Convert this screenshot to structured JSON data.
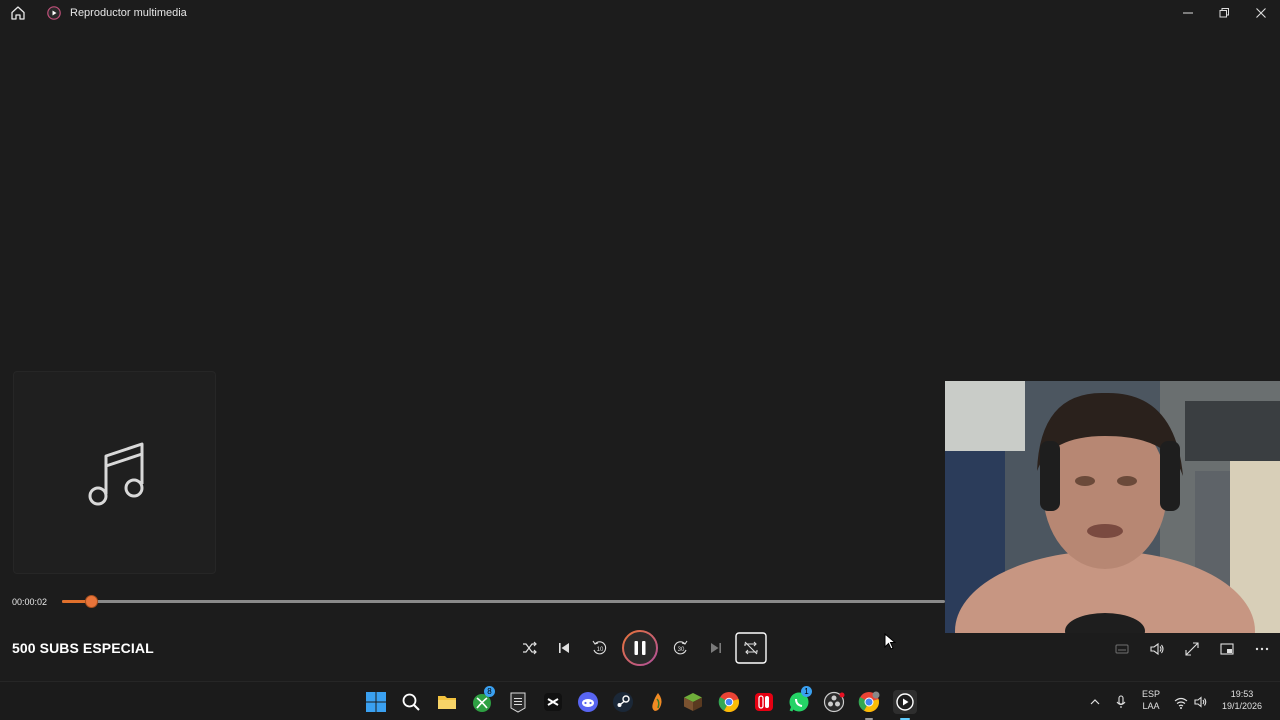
{
  "window": {
    "title": "Reproductor multimedia",
    "icons": {
      "home": "home-icon",
      "app": "media-player-icon",
      "minimize": "minimize-icon",
      "restore": "restore-icon",
      "close": "close-icon"
    }
  },
  "now_playing": {
    "title": "500 SUBS ESPECIAL",
    "elapsed": "00:00:02",
    "progress": 0.033,
    "album_art_icon": "music-note-icon"
  },
  "controls": {
    "shuffle": "shuffle-icon",
    "previous": "previous-icon",
    "rewind": "rewind-10-icon",
    "rewind_seconds": "10",
    "play_pause": "pause-icon",
    "forward": "forward-30-icon",
    "forward_seconds": "30",
    "next": "next-icon",
    "repeat": "repeat-off-icon"
  },
  "right_controls": [
    "captions-icon",
    "volume-icon",
    "fullscreen-icon",
    "miniplayer-icon",
    "more-icon"
  ],
  "colors": {
    "accent": "#e8743a",
    "background": "#1c1c1c",
    "pause_ring": "#c0507a"
  },
  "taskbar": {
    "apps": [
      "windows-start-icon",
      "search-icon",
      "file-explorer-icon",
      "xbox-icon",
      "epic-games-icon",
      "capcut-icon",
      "discord-icon",
      "steam-icon",
      "fl-studio-icon",
      "minecraft-icon",
      "chrome-icon",
      "nintendo-switch-icon",
      "whatsapp-icon",
      "obs-icon",
      "chrome-profile-icon",
      "media-player-icon"
    ],
    "xbox_badge": "8",
    "whatsapp_badge": "1",
    "tray": {
      "language_line1": "ESP",
      "language_line2": "LAA",
      "time": "19:53",
      "date": "19/1/2026"
    }
  }
}
